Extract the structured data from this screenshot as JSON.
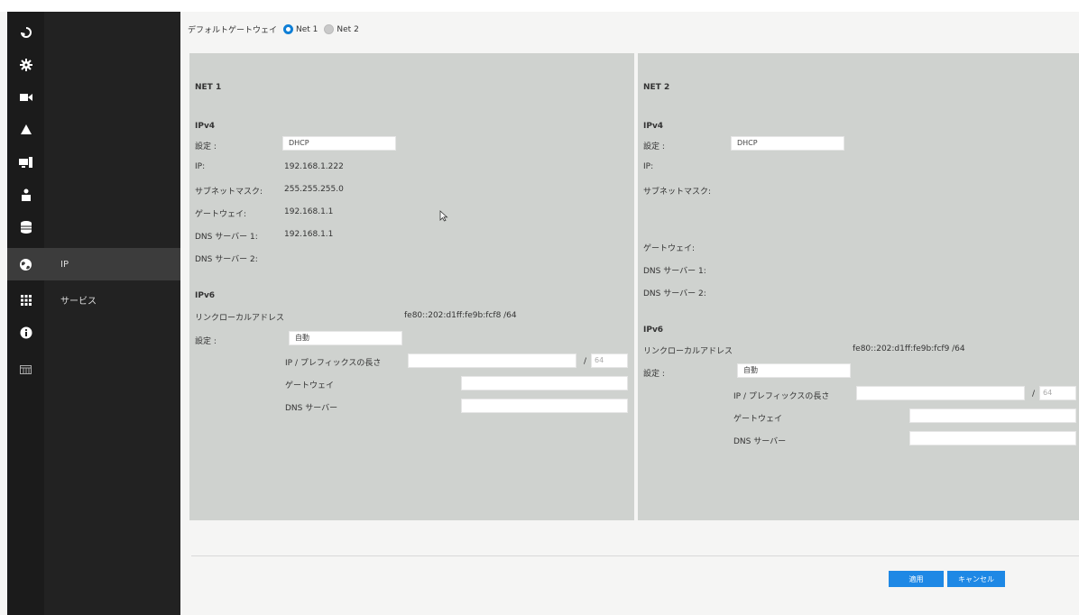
{
  "sidebar": {
    "icons": [
      "logout-icon",
      "gear-icon",
      "camera-icon",
      "alarm-icon",
      "monitor-icon",
      "user-icon",
      "database-icon",
      "network-icon",
      "apps-icon",
      "info-icon",
      "calendar-icon"
    ],
    "items": [
      {
        "label": "IP"
      },
      {
        "label": "サービス"
      }
    ]
  },
  "default_gateway": {
    "label": "デフォルトゲートウェイ",
    "options": [
      "Net 1",
      "Net 2"
    ],
    "selected": "Net 1"
  },
  "net1": {
    "title": "NET 1",
    "ipv4_title": "IPv4",
    "setting_label": "設定 :",
    "setting_value": "DHCP",
    "ip_label": "IP:",
    "ip_value": "192.168.1.222",
    "subnet_label": "サブネットマスク:",
    "subnet_value": "255.255.255.0",
    "gateway_label": "ゲートウェイ:",
    "gateway_value": "192.168.1.1",
    "dns1_label": "DNS サーバー 1:",
    "dns1_value": "192.168.1.1",
    "dns2_label": "DNS サーバー 2:",
    "ipv6_title": "IPv6",
    "linklocal_label": "リンクローカルアドレス",
    "linklocal_value": "fe80::202:d1ff:fe9b:fcf8 /64",
    "v6_setting_label": "設定 :",
    "v6_setting_value": "自動",
    "prefix_label": "IP / プレフィックスの長さ",
    "prefix_sep": "/",
    "prefix_len": "64",
    "v6_gateway_label": "ゲートウェイ",
    "v6_dns_label": "DNS サーバー"
  },
  "net2": {
    "title": "NET 2",
    "ipv4_title": "IPv4",
    "setting_label": "設定 :",
    "setting_value": "DHCP",
    "ip_label": "IP:",
    "subnet_label": "サブネットマスク:",
    "gateway_label": "ゲートウェイ:",
    "dns1_label": "DNS サーバー 1:",
    "dns2_label": "DNS サーバー 2:",
    "ipv6_title": "IPv6",
    "linklocal_label": "リンクローカルアドレス",
    "linklocal_value": "fe80::202:d1ff:fe9b:fcf9 /64",
    "v6_setting_label": "設定 :",
    "v6_setting_value": "自動",
    "prefix_label": "IP / プレフィックスの長さ",
    "prefix_sep": "/",
    "prefix_len": "64",
    "v6_gateway_label": "ゲートウェイ",
    "v6_dns_label": "DNS サーバー"
  },
  "buttons": {
    "apply": "適用",
    "cancel": "キャンセル"
  },
  "colors": {
    "accent": "#1e88e5",
    "sidebar_bg": "#1b1b1b",
    "panel_bg": "#cfd2cf"
  }
}
